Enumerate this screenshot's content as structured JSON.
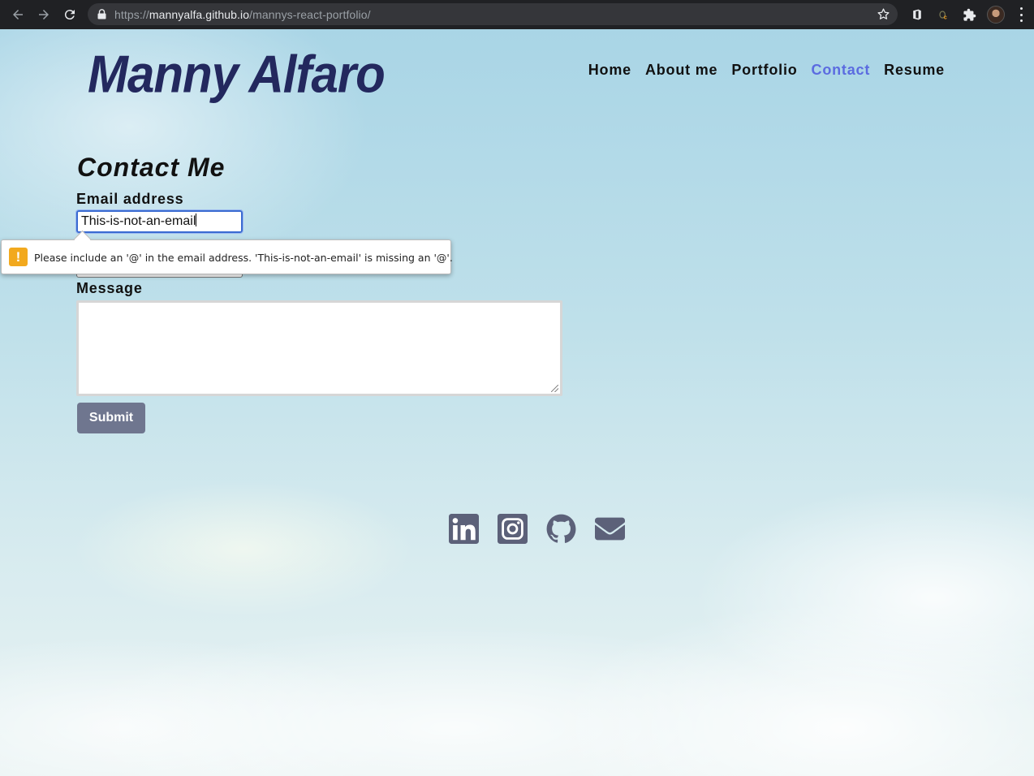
{
  "browser": {
    "url_scheme": "https://",
    "url_host": "mannyalfa.github.io",
    "url_path": "/mannys-react-portfolio/"
  },
  "site": {
    "logo": "Manny Alfaro",
    "nav": [
      {
        "label": "Home",
        "active": false
      },
      {
        "label": "About me",
        "active": false
      },
      {
        "label": "Portfolio",
        "active": false
      },
      {
        "label": "Contact",
        "active": true
      },
      {
        "label": "Resume",
        "active": false
      }
    ]
  },
  "contact": {
    "title": "Contact Me",
    "email_label": "Email address",
    "email_value": "This-is-not-an-email",
    "message_label": "Message",
    "message_value": "",
    "submit_label": "Submit",
    "validation_message": "Please include an '@' in the email address. 'This-is-not-an-email' is missing an '@'."
  },
  "social": [
    {
      "icon": "linkedin-icon"
    },
    {
      "icon": "instagram-icon"
    },
    {
      "icon": "github-icon"
    },
    {
      "icon": "email-icon"
    }
  ],
  "colors": {
    "accent": "#5b6be0",
    "logo": "#23285e",
    "button": "#6f768f",
    "warning": "#f2a91e"
  }
}
